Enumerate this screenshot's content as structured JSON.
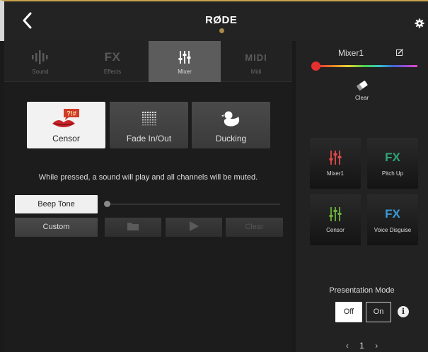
{
  "header": {
    "logo": "RØDE"
  },
  "tabs": [
    {
      "label": "Sound",
      "icon": "sound-wave-icon",
      "active": false
    },
    {
      "label": "Effects",
      "icon": "fx-icon",
      "icon_text": "FX",
      "active": false
    },
    {
      "label": "Mixer",
      "icon": "mixer-sliders-icon",
      "active": true
    },
    {
      "label": "Midi",
      "icon": "midi-icon",
      "icon_text": "MIDI",
      "active": false
    }
  ],
  "modes": [
    {
      "label": "Censor",
      "icon": "censor-mouth-icon",
      "icon_text": "?!#",
      "selected": true
    },
    {
      "label": "Fade In/Out",
      "icon": "dot-grid-icon",
      "selected": false
    },
    {
      "label": "Ducking",
      "icon": "duck-icon",
      "selected": false
    }
  ],
  "description": "While pressed, a sound will play and all channels will be muted.",
  "sound_controls": {
    "beep_label": "Beep Tone",
    "custom_label": "Custom",
    "clear_label": "Clear"
  },
  "right_panel": {
    "pad_name": "Mixer1",
    "clear_label": "Clear",
    "colors": {
      "selected": "#e53030",
      "mixer_pad": "#e24a4a",
      "fx_pad": "#2ea67a",
      "censor_pad": "#6cb33a",
      "voice_pad": "#3a9ad8"
    },
    "pads": [
      {
        "label": "Mixer1",
        "icon": "mixer-sliders-icon"
      },
      {
        "label": "Pitch Up",
        "icon": "fx-icon",
        "icon_text": "FX"
      },
      {
        "label": "Censor",
        "icon": "mixer-sliders-icon"
      },
      {
        "label": "Voice Disguise",
        "icon": "fx-icon",
        "icon_text": "FX"
      }
    ],
    "presentation_mode": {
      "title": "Presentation Mode",
      "off_label": "Off",
      "on_label": "On",
      "selected": "Off",
      "info_symbol": "i"
    },
    "pager": {
      "page": "1",
      "prev": "‹",
      "next": "›"
    }
  }
}
